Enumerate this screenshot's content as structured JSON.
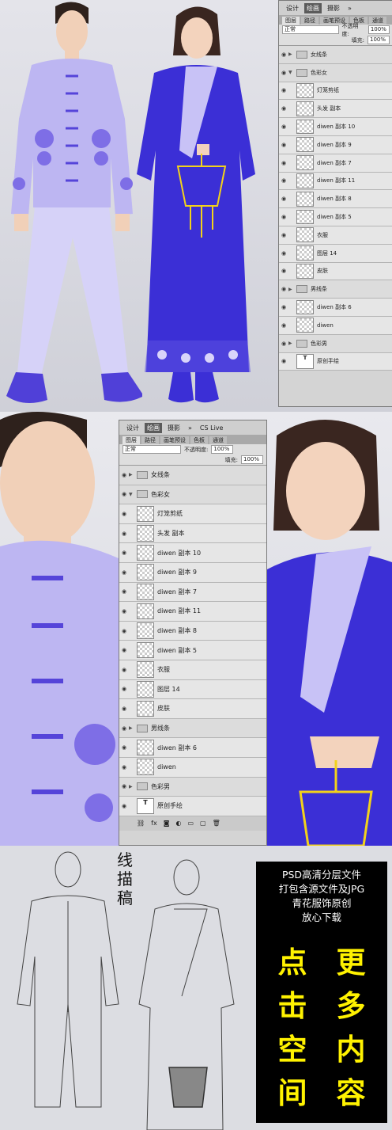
{
  "ps_top": {
    "menu": [
      "设计",
      "绘画",
      "摄影",
      "»"
    ],
    "active": "绘画",
    "cs_live": "CS Live"
  },
  "panel": {
    "tabs": [
      "图层",
      "路径",
      "画笔预设",
      "色板",
      "通道"
    ],
    "blend_mode": "正常",
    "opacity_label": "不透明度:",
    "opacity_value": "100%",
    "fill_label": "填充:",
    "fill_value": "100%",
    "layers": [
      {
        "name": "女线条",
        "type": "group",
        "collapsed": true
      },
      {
        "name": "色彩女",
        "type": "group",
        "collapsed": false
      },
      {
        "name": "灯笼剪纸",
        "type": "layer"
      },
      {
        "name": "头发 副本",
        "type": "layer"
      },
      {
        "name": "diwen 副本 10",
        "type": "layer"
      },
      {
        "name": "diwen 副本 9",
        "type": "layer"
      },
      {
        "name": "diwen 副本 7",
        "type": "layer"
      },
      {
        "name": "diwen 副本 11",
        "type": "layer"
      },
      {
        "name": "diwen 副本 8",
        "type": "layer"
      },
      {
        "name": "diwen 副本 5",
        "type": "layer"
      },
      {
        "name": "衣服",
        "type": "layer"
      },
      {
        "name": "图层 14",
        "type": "layer"
      },
      {
        "name": "皮肤",
        "type": "layer"
      },
      {
        "name": "男线条",
        "type": "group",
        "collapsed": true
      },
      {
        "name": "diwen 副本 6",
        "type": "layer"
      },
      {
        "name": "diwen",
        "type": "layer"
      },
      {
        "name": "色彩男",
        "type": "group",
        "collapsed": true
      },
      {
        "name": "原创手绘",
        "type": "text"
      }
    ]
  },
  "sketch_label": "线描稿",
  "promo": {
    "lines": [
      "PSD高清分层文件",
      "打包含源文件及JPG",
      "青花服饰原创",
      "放心下载"
    ],
    "left_col": [
      "点",
      "击",
      "空",
      "间"
    ],
    "right_col": [
      "更",
      "多",
      "内",
      "容"
    ]
  },
  "colors": {
    "male_jacket": "#bdb6f2",
    "female_robe": "#3b2fd6",
    "lantern": "#f2d21b",
    "promo_yellow": "#fff200"
  }
}
